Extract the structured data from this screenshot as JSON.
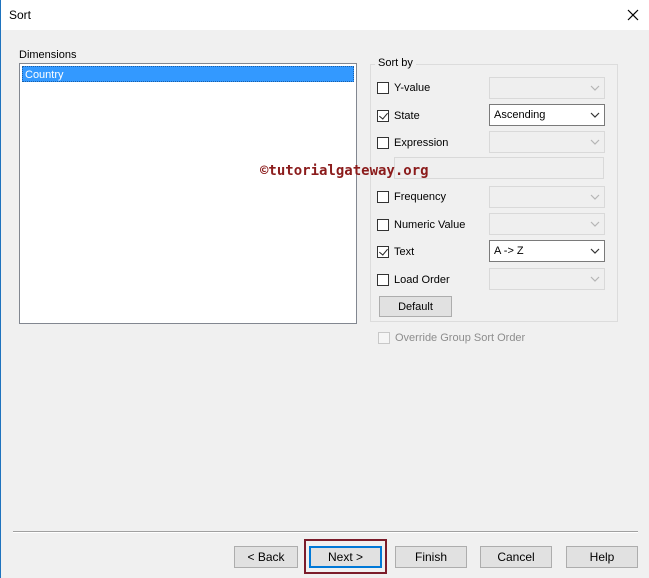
{
  "window": {
    "title": "Sort",
    "close_icon": "close-icon"
  },
  "dimensions": {
    "label": "Dimensions",
    "items": [
      "Country"
    ],
    "selected_index": 0
  },
  "sort_by": {
    "legend": "Sort by",
    "options": [
      {
        "label": "Y-value",
        "checked": false,
        "combo": "",
        "combo_enabled": false
      },
      {
        "label": "State",
        "checked": true,
        "combo": "Ascending",
        "combo_enabled": true
      },
      {
        "label": "Expression",
        "checked": false,
        "combo": "",
        "combo_enabled": false
      },
      {
        "label": "Frequency",
        "checked": false,
        "combo": "",
        "combo_enabled": false
      },
      {
        "label": "Numeric Value",
        "checked": false,
        "combo": "",
        "combo_enabled": false
      },
      {
        "label": "Text",
        "checked": true,
        "combo": "A -> Z",
        "combo_enabled": true
      },
      {
        "label": "Load Order",
        "checked": false,
        "combo": "",
        "combo_enabled": false
      }
    ],
    "expression_value": "",
    "default_label": "Default"
  },
  "watermark": "©tutorialgateway.org",
  "override": {
    "label": "Override Group Sort Order",
    "checked": false,
    "enabled": false
  },
  "footer": {
    "back_label": "< Back",
    "next_label": "Next >",
    "finish_label": "Finish",
    "cancel_label": "Cancel",
    "help_label": "Help"
  },
  "colors": {
    "selection": "#3399ff",
    "highlight_box": "#7b1c2a",
    "watermark": "#8b1c1c"
  }
}
